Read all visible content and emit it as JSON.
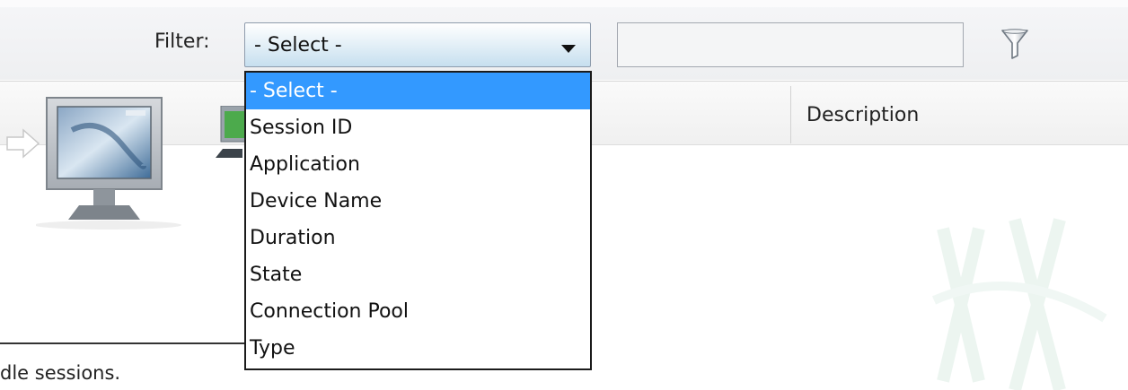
{
  "toolbar": {
    "filter_label": "Filter:",
    "select_value": "- Select -",
    "filter_text": ""
  },
  "dropdown": {
    "options": [
      {
        "label": "- Select -",
        "selected": true
      },
      {
        "label": "Session ID",
        "selected": false
      },
      {
        "label": "Application",
        "selected": false
      },
      {
        "label": "Device Name",
        "selected": false
      },
      {
        "label": "Duration",
        "selected": false
      },
      {
        "label": "State",
        "selected": false
      },
      {
        "label": "Connection Pool",
        "selected": false
      },
      {
        "label": "Type",
        "selected": false
      }
    ]
  },
  "table": {
    "description_header": "Description"
  },
  "status": {
    "text": "dle sessions."
  },
  "colors": {
    "selection": "#3399ff",
    "dropdown_border": "#1b1b1b"
  }
}
